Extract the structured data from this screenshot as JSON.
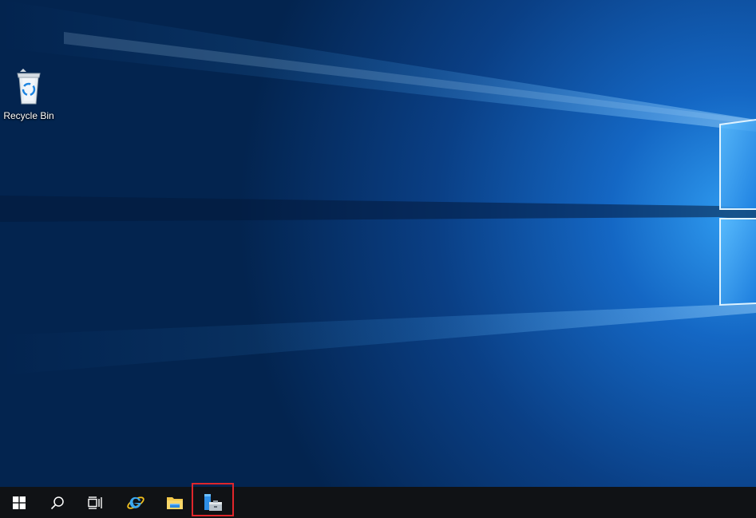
{
  "desktop": {
    "icons": [
      {
        "label": "Recycle Bin",
        "icon": "recycle-bin-icon"
      }
    ]
  },
  "taskbar": {
    "buttons": [
      {
        "name": "start-button",
        "icon": "windows-logo-icon"
      },
      {
        "name": "search-button",
        "icon": "search-icon"
      },
      {
        "name": "task-view-button",
        "icon": "task-view-icon"
      },
      {
        "name": "internet-explorer-button",
        "icon": "internet-explorer-icon"
      },
      {
        "name": "file-explorer-button",
        "icon": "folder-icon"
      },
      {
        "name": "server-manager-button",
        "icon": "server-manager-icon",
        "highlighted": true
      }
    ]
  },
  "colors": {
    "taskbar_bg": "#101215",
    "highlight_border": "#e0262b",
    "wallpaper_dark": "#03244f",
    "wallpaper_light": "#2a8fe8"
  }
}
